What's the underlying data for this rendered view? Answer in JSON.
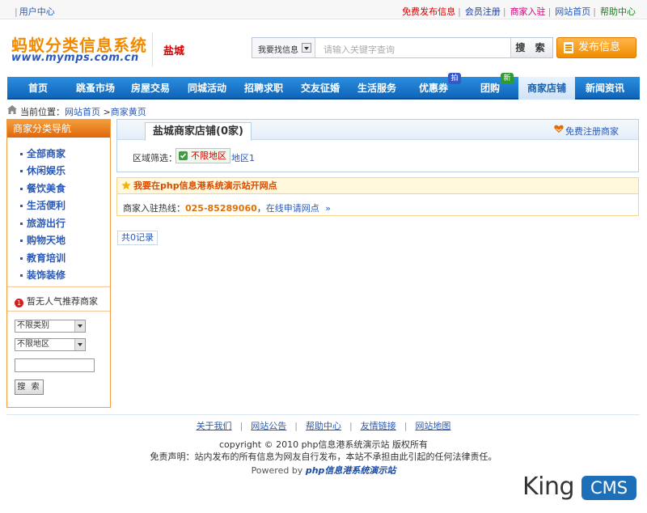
{
  "topbar": {
    "user_center": "用户中心",
    "links": [
      {
        "label": "免费发布信息",
        "color": "#d40000"
      },
      {
        "label": "会员注册",
        "color": "#1a3c9c"
      },
      {
        "label": "商家入驻",
        "color": "#d4007f"
      },
      {
        "label": "网站首页",
        "color": "#2b59b5"
      },
      {
        "label": "帮助中心",
        "color": "#1a7f1a"
      }
    ]
  },
  "header": {
    "logo_title": "蚂蚁分类信息系统",
    "logo_url": "www.mymps.com.cn",
    "city": "盐城",
    "search": {
      "type_label": "我要找信息",
      "placeholder": "请输入关键字查询",
      "button": "搜 索"
    },
    "post_button": "发布信息"
  },
  "nav": {
    "items": [
      {
        "label": "首页"
      },
      {
        "label": "跳蚤市场"
      },
      {
        "label": "房屋交易"
      },
      {
        "label": "同城活动"
      },
      {
        "label": "招聘求职"
      },
      {
        "label": "交友征婚"
      },
      {
        "label": "生活服务"
      },
      {
        "label": "优惠券",
        "badge": "拍"
      },
      {
        "label": "团购",
        "badge": "新"
      },
      {
        "label": "商家店铺",
        "active": true
      },
      {
        "label": "新闻资讯"
      }
    ]
  },
  "breadcrumb": {
    "prefix": "当前位置：",
    "home": "网站首页",
    "separator": ">",
    "current": "商家黄页"
  },
  "sidebar": {
    "title": "商家分类导航",
    "categories": [
      "全部商家",
      "休闲娱乐",
      "餐饮美食",
      "生活便利",
      "旅游出行",
      "购物天地",
      "教育培训",
      "装饰装修"
    ],
    "notice_num": "1",
    "notice": "暂无人气推荐商家",
    "type_select": "不限类别",
    "area_select": "不限地区",
    "search_button": "搜 索"
  },
  "panel": {
    "title": "盐城商家店铺(0家)",
    "register": "免费注册商家",
    "filter_label": "区域筛选：",
    "filter_selected": "不限地区",
    "area_option": "地区1"
  },
  "notice_box": {
    "title": "我要在php信息港系统演示站开网点",
    "line_prefix": "商家入驻热线：",
    "phone": "025-85289060",
    "comma": "，",
    "apply": "在线申请网点",
    "arrow": "»"
  },
  "result_count": "共0记录",
  "footer": {
    "links": [
      "关于我们",
      "网站公告",
      "帮助中心",
      "友情链接",
      "网站地图"
    ],
    "copyright": "copyright © 2010 php信息港系统演示站 版权所有",
    "disclaimer": "免责声明：站内发布的所有信息为网友自行发布，本站不承担由此引起的任何法律责任。",
    "powered_prefix": "Powered by",
    "powered_brand": "php信息港系统演示站"
  },
  "watermark": {
    "king": "King",
    "cms": "CMS"
  }
}
